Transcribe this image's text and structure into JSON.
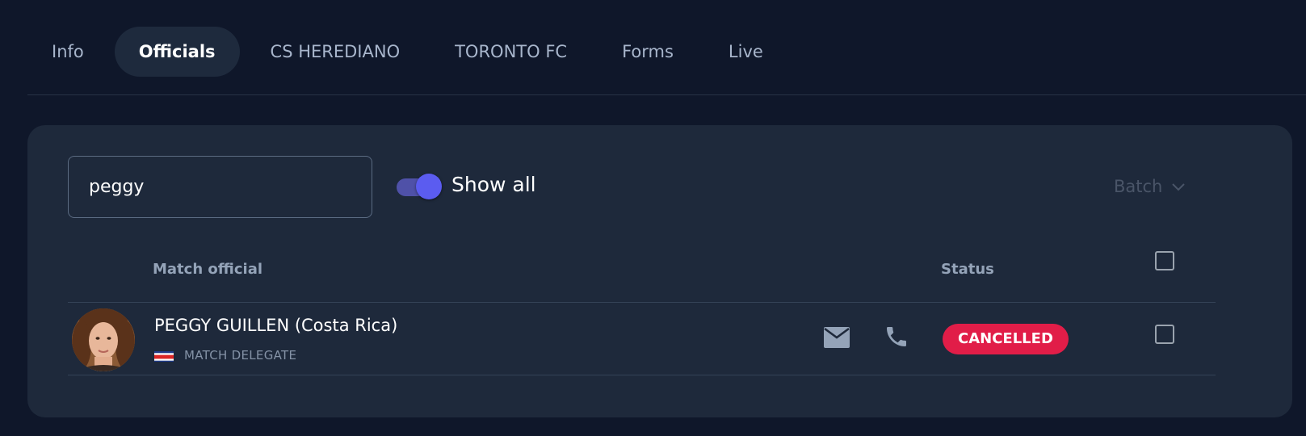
{
  "tabs": [
    {
      "label": "Info",
      "active": false
    },
    {
      "label": "Officials",
      "active": true
    },
    {
      "label": "CS HEREDIANO",
      "active": false
    },
    {
      "label": "TORONTO FC",
      "active": false
    },
    {
      "label": "Forms",
      "active": false
    },
    {
      "label": "Live",
      "active": false
    }
  ],
  "filters": {
    "search_value": "peggy",
    "show_all_label": "Show all",
    "show_all_on": true,
    "batch_label": "Batch"
  },
  "table": {
    "headers": {
      "official": "Match official",
      "status": "Status"
    },
    "rows": [
      {
        "name": "PEGGY GUILLEN (Costa Rica)",
        "role": "MATCH DELEGATE",
        "status": "CANCELLED",
        "flag": "costa-rica-flag"
      }
    ]
  },
  "colors": {
    "background": "#0f172a",
    "card": "#1e293b",
    "accent": "#5b5cf0",
    "status_cancelled": "#e11d48"
  }
}
